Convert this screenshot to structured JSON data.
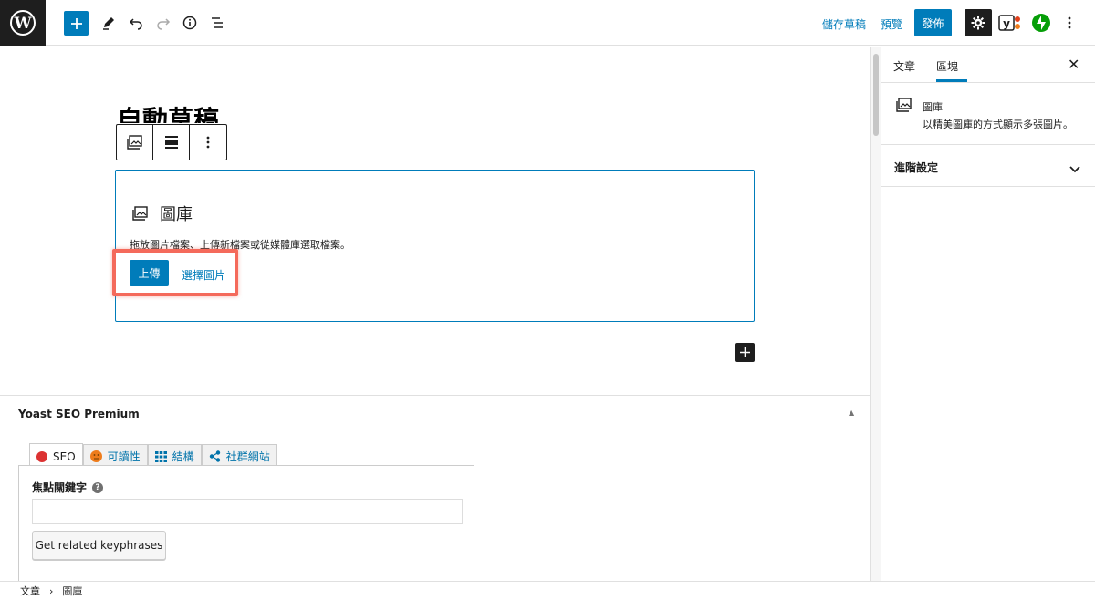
{
  "topbar": {
    "save_draft": "儲存草稿",
    "preview": "預覽",
    "publish": "發佈",
    "icons": [
      "wordpress-logo-icon",
      "plus-icon",
      "pencil-icon",
      "undo-icon",
      "redo-icon",
      "info-icon",
      "list-view-icon",
      "gear-icon",
      "yoast-icon",
      "jetpack-icon",
      "more-vertical-icon"
    ]
  },
  "editor": {
    "post_title": "自動草稿",
    "gallery": {
      "title": "圖庫",
      "description": "拖放圖片檔案、上傳新檔案或從媒體庫選取檔案。",
      "upload": "上傳",
      "select": "選擇圖片"
    }
  },
  "yoast": {
    "title": "Yoast SEO Premium",
    "tabs": [
      {
        "label": "SEO",
        "icon": "red-dot-icon"
      },
      {
        "label": "可讀性",
        "icon": "orange-face-icon"
      },
      {
        "label": "結構",
        "icon": "grid-icon"
      },
      {
        "label": "社群網站",
        "icon": "share-icon"
      }
    ],
    "focus_keyphrase_label": "焦點關鍵字",
    "focus_keyphrase_value": "",
    "related_button": "Get related keyphrases"
  },
  "sidebar": {
    "tab_post": "文章",
    "tab_block": "區塊",
    "block_title": "圖庫",
    "block_desc": "以精美圖庫的方式顯示多張圖片。",
    "advanced": "進階設定"
  },
  "footer": {
    "crumb_1": "文章",
    "separator": "›",
    "crumb_2": "圖庫"
  },
  "colors": {
    "accent": "#007cba",
    "highlight": "#f46a5b",
    "dark": "#1e1e1e"
  }
}
